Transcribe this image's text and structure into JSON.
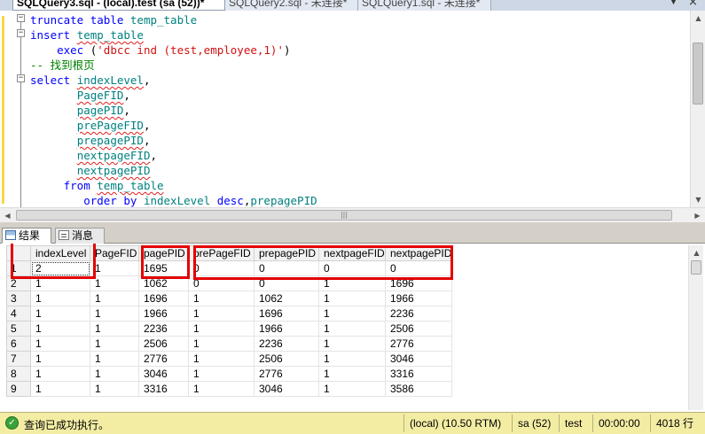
{
  "tabs": [
    {
      "label": "SQLQuery3.sql - (local).test (sa (52))*",
      "active": true
    },
    {
      "label": "SQLQuery2.sql - 未连接*",
      "active": false
    },
    {
      "label": "SQLQuery1.sql - 未连接*",
      "active": false
    }
  ],
  "tab_close_symbol": "×",
  "editor": {
    "lines": [
      {
        "tokens": [
          {
            "t": "truncate table ",
            "c": "kw"
          },
          {
            "t": "temp_table",
            "c": "obj"
          }
        ]
      },
      {
        "tokens": [
          {
            "t": "insert ",
            "c": "kw"
          },
          {
            "t": "temp_table",
            "c": "obj sq"
          }
        ]
      },
      {
        "tokens": [
          {
            "t": "    exec ",
            "c": "kw"
          },
          {
            "t": "(",
            "c": "plain"
          },
          {
            "t": "'dbcc ind (test,employee,1)'",
            "c": "str"
          },
          {
            "t": ")",
            "c": "plain"
          }
        ]
      },
      {
        "tokens": [
          {
            "t": "-- 找到根页",
            "c": "cm"
          }
        ]
      },
      {
        "tokens": [
          {
            "t": "select ",
            "c": "kw"
          },
          {
            "t": "indexLevel",
            "c": "obj sq"
          },
          {
            "t": ",",
            "c": "plain"
          }
        ]
      },
      {
        "tokens": [
          {
            "t": "       ",
            "c": "plain"
          },
          {
            "t": "PageFID",
            "c": "obj sq"
          },
          {
            "t": ",",
            "c": "plain"
          }
        ]
      },
      {
        "tokens": [
          {
            "t": "       ",
            "c": "plain"
          },
          {
            "t": "pagePID",
            "c": "obj sq"
          },
          {
            "t": ",",
            "c": "plain"
          }
        ]
      },
      {
        "tokens": [
          {
            "t": "       ",
            "c": "plain"
          },
          {
            "t": "prePageFID",
            "c": "obj sq"
          },
          {
            "t": ",",
            "c": "plain"
          }
        ]
      },
      {
        "tokens": [
          {
            "t": "       ",
            "c": "plain"
          },
          {
            "t": "prepagePID",
            "c": "obj sq"
          },
          {
            "t": ",",
            "c": "plain"
          }
        ]
      },
      {
        "tokens": [
          {
            "t": "       ",
            "c": "plain"
          },
          {
            "t": "nextpageFID",
            "c": "obj sq"
          },
          {
            "t": ",",
            "c": "plain"
          }
        ]
      },
      {
        "tokens": [
          {
            "t": "       ",
            "c": "plain"
          },
          {
            "t": "nextpagePID",
            "c": "obj sq"
          }
        ]
      },
      {
        "tokens": [
          {
            "t": "     from ",
            "c": "kw"
          },
          {
            "t": "temp_table",
            "c": "obj sq"
          }
        ]
      },
      {
        "tokens": [
          {
            "t": "        order by ",
            "c": "kw"
          },
          {
            "t": "indexLevel",
            "c": "obj sq"
          },
          {
            "t": " desc",
            "c": "kw"
          },
          {
            "t": ",",
            "c": "plain"
          },
          {
            "t": "prepagePID",
            "c": "obj sq"
          }
        ]
      }
    ]
  },
  "results_tabs": {
    "results": "结果",
    "messages": "消息"
  },
  "grid": {
    "columns": [
      "indexLevel",
      "PageFID",
      "pagePID",
      "prePageFID",
      "prepagePID",
      "nextpageFID",
      "nextpagePID"
    ],
    "rows": [
      [
        "1",
        "2",
        "1",
        "1695",
        "0",
        "0",
        "0",
        "0"
      ],
      [
        "2",
        "1",
        "1",
        "1062",
        "0",
        "0",
        "1",
        "1696"
      ],
      [
        "3",
        "1",
        "1",
        "1696",
        "1",
        "1062",
        "1",
        "1966"
      ],
      [
        "4",
        "1",
        "1",
        "1966",
        "1",
        "1696",
        "1",
        "2236"
      ],
      [
        "5",
        "1",
        "1",
        "2236",
        "1",
        "1966",
        "1",
        "2506"
      ],
      [
        "6",
        "1",
        "1",
        "2506",
        "1",
        "2236",
        "1",
        "2776"
      ],
      [
        "7",
        "1",
        "1",
        "2776",
        "1",
        "2506",
        "1",
        "3046"
      ],
      [
        "8",
        "1",
        "1",
        "3046",
        "1",
        "2776",
        "1",
        "3316"
      ],
      [
        "9",
        "1",
        "1",
        "3316",
        "1",
        "3046",
        "1",
        "3586"
      ]
    ]
  },
  "status": {
    "message": "查询已成功执行。",
    "server": "(local) (10.50 RTM)",
    "user": "sa (52)",
    "database": "test",
    "elapsed": "00:00:00",
    "rows": "4018 行"
  },
  "colors": {
    "keyword": "#0000ff",
    "string": "#d01010",
    "comment": "#008000",
    "object": "#008080",
    "highlight_box": "#e40000",
    "status_bar": "#f3eda4"
  }
}
